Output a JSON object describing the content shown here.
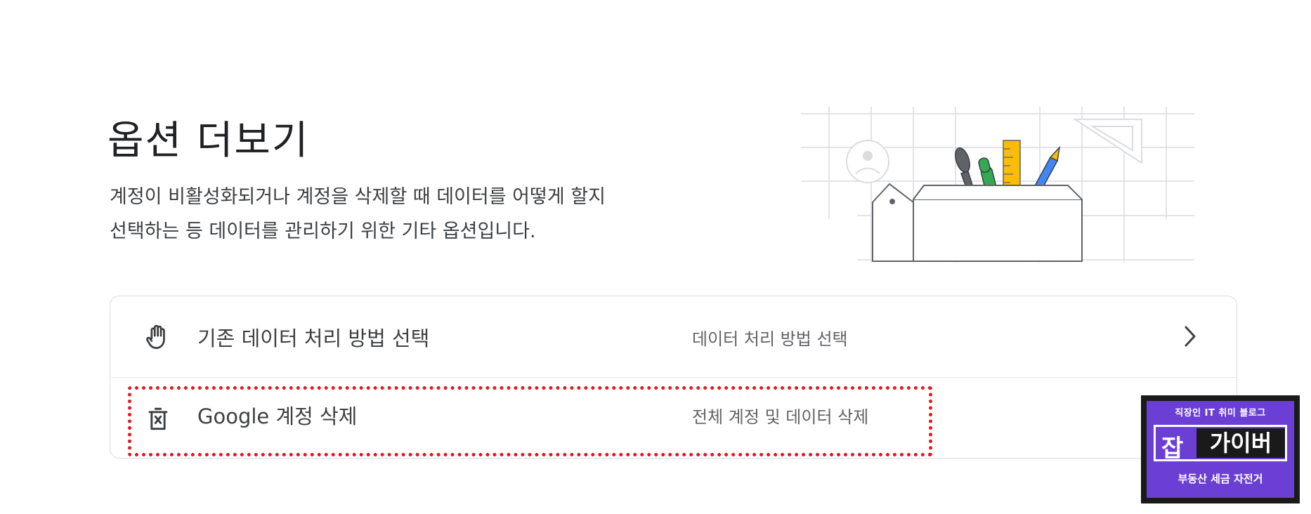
{
  "header": {
    "title": "옵션 더보기",
    "description_line1": "계정이 비활성화되거나 계정을 삭제할 때 데이터를 어떻게 할지",
    "description_line2": "선택하는 등 데이터를 관리하기 위한 기타 옵션입니다."
  },
  "options": [
    {
      "icon": "hand-icon",
      "label": "기존 데이터 처리 방법 선택",
      "value": "데이터 처리 방법 선택"
    },
    {
      "icon": "delete-account-icon",
      "label": "Google 계정 삭제",
      "value": "전체 계정 및 데이터 삭제"
    }
  ],
  "watermark": {
    "top": "직장인 IT 취미 블로그",
    "big": "잡",
    "box": "가이버",
    "bottom": "부동산 세금 자전거"
  },
  "colors": {
    "highlight": "#e8141b",
    "watermark_bg": "#6b3fd4",
    "border": "#dadce0"
  }
}
